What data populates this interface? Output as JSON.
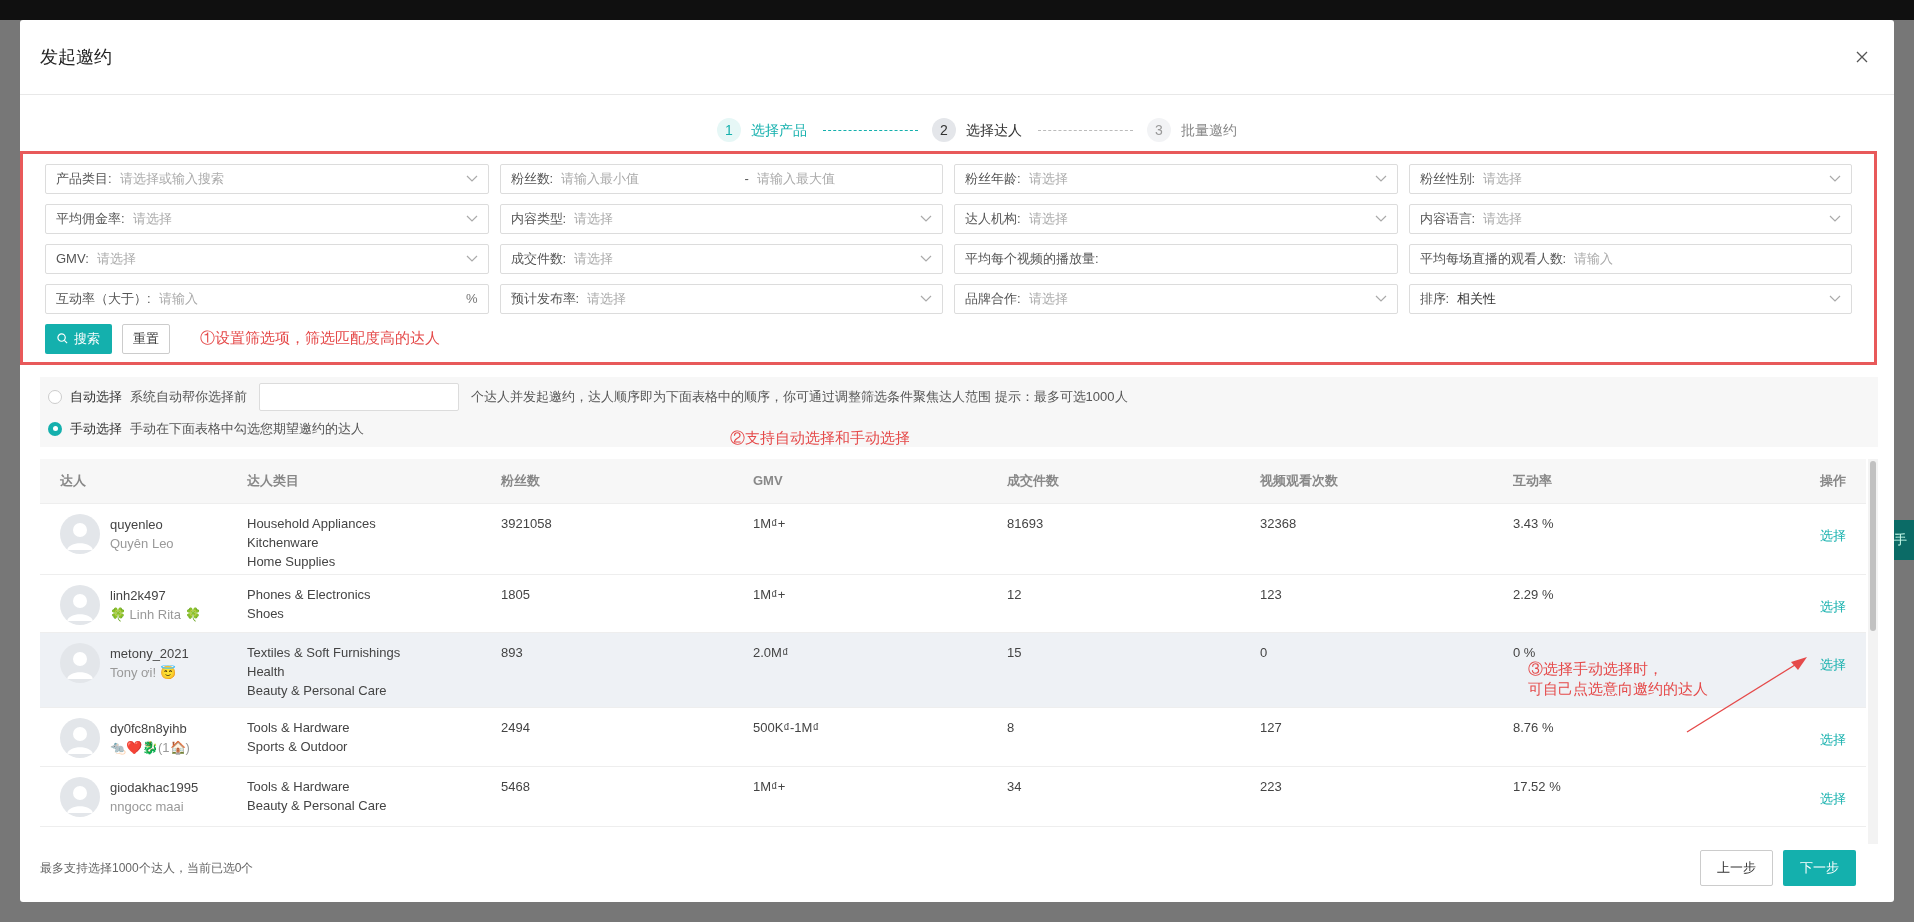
{
  "dialog": {
    "title": "发起邀约"
  },
  "steps": [
    {
      "number": "1",
      "label": "选择产品",
      "completed": true,
      "selected": false
    },
    {
      "number": "2",
      "label": "选择达人",
      "completed": false,
      "selected": true
    },
    {
      "number": "3",
      "label": "批量邀约",
      "completed": false,
      "selected": false
    }
  ],
  "filters": [
    {
      "kind": "select",
      "label": "产品类目:",
      "placeholder": "请选择或输入搜索"
    },
    {
      "kind": "range",
      "label": "粉丝数:",
      "placeholder": "请输入最小值",
      "separator": "-",
      "placeholder_max": "请输入最大值"
    },
    {
      "kind": "select",
      "label": "粉丝年龄:",
      "placeholder": "请选择"
    },
    {
      "kind": "select",
      "label": "粉丝性别:",
      "placeholder": "请选择"
    },
    {
      "kind": "select",
      "label": "平均佣金率:",
      "placeholder": "请选择"
    },
    {
      "kind": "select",
      "label": "内容类型:",
      "placeholder": "请选择"
    },
    {
      "kind": "select",
      "label": "达人机构:",
      "placeholder": "请选择"
    },
    {
      "kind": "select",
      "label": "内容语言:",
      "placeholder": "请选择"
    },
    {
      "kind": "select",
      "label": "GMV:",
      "placeholder": "请选择"
    },
    {
      "kind": "select",
      "label": "成交件数:",
      "placeholder": "请选择"
    },
    {
      "kind": "input",
      "label": "平均每个视频的播放量:"
    },
    {
      "kind": "input",
      "label": "平均每场直播的观看人数:",
      "placeholder": "请输入"
    },
    {
      "kind": "input",
      "label": "互动率（大于）:",
      "placeholder": "请输入",
      "suffix": "%"
    },
    {
      "kind": "select",
      "label": "预计发布率:",
      "placeholder": "请选择"
    },
    {
      "kind": "select",
      "label": "品牌合作:",
      "placeholder": "请选择"
    },
    {
      "kind": "select",
      "label": "排序:",
      "value": "相关性"
    }
  ],
  "search_button": "搜索",
  "reset_button": "重置",
  "selection_modes": [
    {
      "kind": "with_count",
      "label": "自动选择",
      "text_before": "系统自动帮你选择前",
      "text_after": "个达人并发起邀约，达人顺序即为下面表格中的顺序，你可通过调整筛选条件聚焦达人范围 提示：最多可选1000人",
      "selected": false
    },
    {
      "kind": "plain",
      "label": "手动选择",
      "text_before": "手动在下面表格中勾选您期望邀约的达人",
      "selected": true
    }
  ],
  "table": {
    "columns": [
      "达人",
      "达人类目",
      "粉丝数",
      "GMV",
      "成交件数",
      "视频观看次数",
      "互动率",
      "操作"
    ],
    "rows": [
      {
        "handle": "quyenleo",
        "nickname": "Quyên Leo",
        "categories": [
          "Household Appliances",
          "Kitchenware",
          "Home Supplies"
        ],
        "followers": "3921058",
        "gmv": "1M₫+",
        "orders": "81693",
        "video_views": "32368",
        "engagement": "3.43 %",
        "action": "选择",
        "hovered": false
      },
      {
        "handle": "linh2k497",
        "nickname": "🍀 Linh Rita 🍀",
        "categories": [
          "Phones & Electronics",
          "Shoes"
        ],
        "followers": "1805",
        "gmv": "1M₫+",
        "orders": "12",
        "video_views": "123",
        "engagement": "2.29 %",
        "action": "选择",
        "hovered": false
      },
      {
        "handle": "metony_2021",
        "nickname": "Tony ơi! 😇",
        "categories": [
          "Textiles & Soft Furnishings",
          "Health",
          "Beauty & Personal Care"
        ],
        "followers": "893",
        "gmv": "2.0M₫",
        "orders": "15",
        "video_views": "0",
        "engagement": "0 %",
        "action": "选择",
        "hovered": true
      },
      {
        "handle": "dy0fc8n8yihb",
        "nickname": "🐀❤️🐉(1🏠)",
        "categories": [
          "Tools & Hardware",
          "Sports & Outdoor"
        ],
        "followers": "2494",
        "gmv": "500K₫-1M₫",
        "orders": "8",
        "video_views": "127",
        "engagement": "8.76 %",
        "action": "选择",
        "hovered": false
      },
      {
        "handle": "giodakhac1995",
        "nickname": "nngocc maai",
        "categories": [
          "Tools & Hardware",
          "Beauty & Personal Care"
        ],
        "followers": "5468",
        "gmv": "1M₫+",
        "orders": "34",
        "video_views": "223",
        "engagement": "17.52 %",
        "action": "选择",
        "hovered": false
      }
    ]
  },
  "footer": {
    "note": "最多支持选择1000个达人，当前已选0个",
    "buttons": [
      {
        "label": "上一步",
        "kind": "secondary"
      },
      {
        "label": "下一步",
        "kind": "primary"
      }
    ]
  },
  "annotations": [
    "①设置筛选项，筛选匹配度高的达人",
    "②支持自动选择和手动选择",
    "③选择手动选择时，",
    "可自己点选意向邀约的达人"
  ],
  "background": {
    "side_tab": "手"
  }
}
